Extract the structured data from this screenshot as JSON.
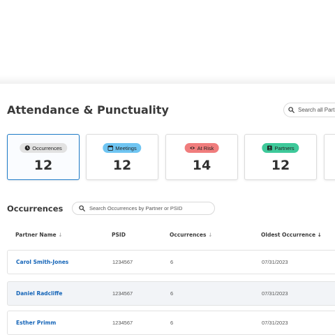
{
  "header": {
    "title": "Attendance & Punctuality",
    "search_placeholder": "Search all Partners"
  },
  "cards": [
    {
      "label": "Occurrences",
      "count": "12",
      "icon": "clock-icon",
      "color": "#e2e2e2",
      "active": true
    },
    {
      "label": "Meetings",
      "count": "12",
      "icon": "calendar-icon",
      "color": "#6fc5f2",
      "active": false
    },
    {
      "label": "At Risk",
      "count": "14",
      "icon": "eye-icon",
      "color": "#f07d7d",
      "active": false
    },
    {
      "label": "Partners",
      "count": "12",
      "icon": "person-badge-icon",
      "color": "#3ec99a",
      "active": false
    }
  ],
  "occurrences": {
    "title": "Occurrences",
    "search_placeholder": "Search Occurrences by Partner or PSID",
    "columns": {
      "name": "Partner Name",
      "psid": "PSID",
      "occurrences": "Occurrences",
      "oldest": "Oldest Occurrence"
    },
    "sort_arrow": "↓",
    "rows": [
      {
        "name": "Carol Smith-Jones",
        "psid": "1234567",
        "occurrences": "6",
        "oldest": "07/31/2023"
      },
      {
        "name": "Daniel Radcliffe",
        "psid": "1234567",
        "occurrences": "6",
        "oldest": "07/31/2023"
      },
      {
        "name": "Esther Primm",
        "psid": "1234567",
        "occurrences": "6",
        "oldest": "07/31/2023"
      }
    ]
  }
}
